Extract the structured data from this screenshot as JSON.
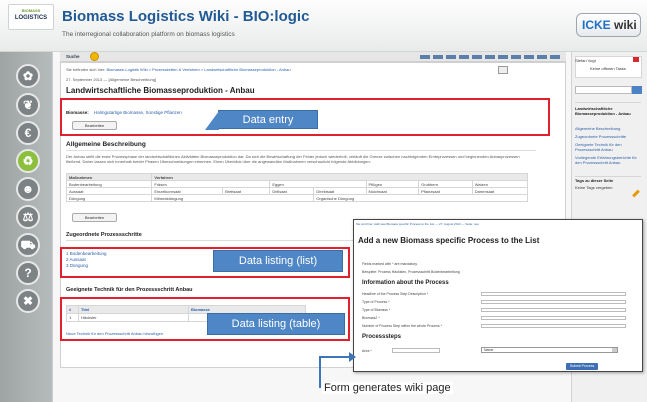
{
  "header": {
    "logo_top": "BIOMASS",
    "logo_main": "LOGISTICS",
    "title": "Biomass Logistics Wiki - BIO:logic",
    "subtitle": "The interregional collaboration platform on biomass logistics",
    "brand_left": "ICKE",
    "brand_right": "wiki"
  },
  "sidebar": {
    "icons": [
      "leaf-icon",
      "leaf-icon",
      "euro-icon",
      "recycle-icon",
      "people-icon",
      "scales-icon",
      "tractor-icon",
      "question-icon",
      "tools-icon"
    ]
  },
  "page": {
    "search_label": "Suche",
    "help_label": "1 (1:1)",
    "breadcrumb_prefix": "Sie befinden sich hier: ",
    "breadcrumb_links": "Biomasse-Logistik Wiki > Prozessketten & Verfahren > Landwirtschaftliche Biomasseproduktion - Anbau",
    "breadcrumb_date": "27. September 2013 — [Allgemeine Beschreibung]",
    "title": "Landwirtschaftliche Biomasseproduktion - Anbau",
    "biomasse_label": "Biomasse:",
    "biomasse_values": "Halmgutartige Biomasse, Sonstige Pflanzen",
    "edit_button": "Bearbeiten",
    "allg_heading": "Allgemeine Beschreibung",
    "allg_text": "Der Anbau stellt die erste Prozessphase der landwirtschaftlichen Aktivitäten Biomasseproduktion dar. Da sich die Bewirtschaftung der Felder jedoch wiederholt, verläuft die Grenze zwischen nachfolgenden Ernteprozessen und beginnenden Anbauprozessen fließend. Daher lassen sich innerhalb beider Phasen Überschneidungen erkennen. Einen Überblick über die angewandten Maßnahmen verschaulicht folgende Abbildungen:",
    "steps_table": {
      "headers": [
        "Maßnahmen",
        "Verfahren",
        "",
        "",
        "",
        ""
      ],
      "rows": [
        [
          "Bodenbearbeitung",
          "Fräsen",
          "Eggen",
          "",
          "Pflügen",
          "Grubbern",
          "Walzen"
        ],
        [
          "Aussaat",
          "Einzelkornsaat",
          "Breitsaat",
          "Drillsaat",
          "Direktsaat",
          "Mulchsaat",
          "Pflanzsaat",
          "Dammsaat"
        ],
        [
          "Düngung",
          "Mineraldüngung",
          "",
          "",
          "Organische Düngung",
          "",
          ""
        ]
      ]
    },
    "zug_heading": "Zugeordnete Prozessschritte",
    "list_items": [
      "1 Bodenbearbeitung",
      "2 Aussaat",
      "3 Düngung"
    ],
    "geeig_heading": "Geeignete Technik für den Prozessschritt Anbau",
    "table_headers": [
      "#",
      "Titel",
      "Biomasse"
    ],
    "table_row": [
      "1",
      "Häcksler",
      ""
    ],
    "table_link": "Neue Technik für den Prozessschritt Anbau hinzufügen"
  },
  "callouts": {
    "entry": "Data entry",
    "list": "Data listing (list)",
    "table": "Data listing (table)"
  },
  "right_panel": {
    "user": "Stefan Vogt",
    "user_sub": "Keine offenen Tasks",
    "page_title": "Landwirtschaftliche Biomasseproduktion - Anbau",
    "links": [
      "Allgemeine Beschreibung",
      "Zugeordnete Prozessschritte",
      "Geeignete Technik für den Prozessschritt Anbau",
      "Vorliegende Erfahrungsberichte für den Prozessschritt Anbau"
    ],
    "tags_heading": "Tags zu dieser Seite",
    "tags_text": "Keine Tags vergeben"
  },
  "form": {
    "top_text": "Sie sind hier: Add new Biomass specific Process to the List — 27. August 2013 — Seite: neu",
    "title": "Add a new Biomass specific Process to the List",
    "note1": "Fields marked with * are mandatory.",
    "note2": "Beispiele: Prozess Häckslen, Prozessschritt Bodenbearbeitung",
    "info_heading": "Information about the Process",
    "fields": [
      "Headline of the Process Step Description *",
      "Type of Process *",
      "Type of Biomass *",
      "Biomass2 *",
      "Number of Process Step within the whole Process *"
    ],
    "steps_heading": "Processsteps",
    "area_label": "Area *",
    "select_value": "Name",
    "submit": "Submit Process"
  },
  "caption": "Form generates wiki page"
}
